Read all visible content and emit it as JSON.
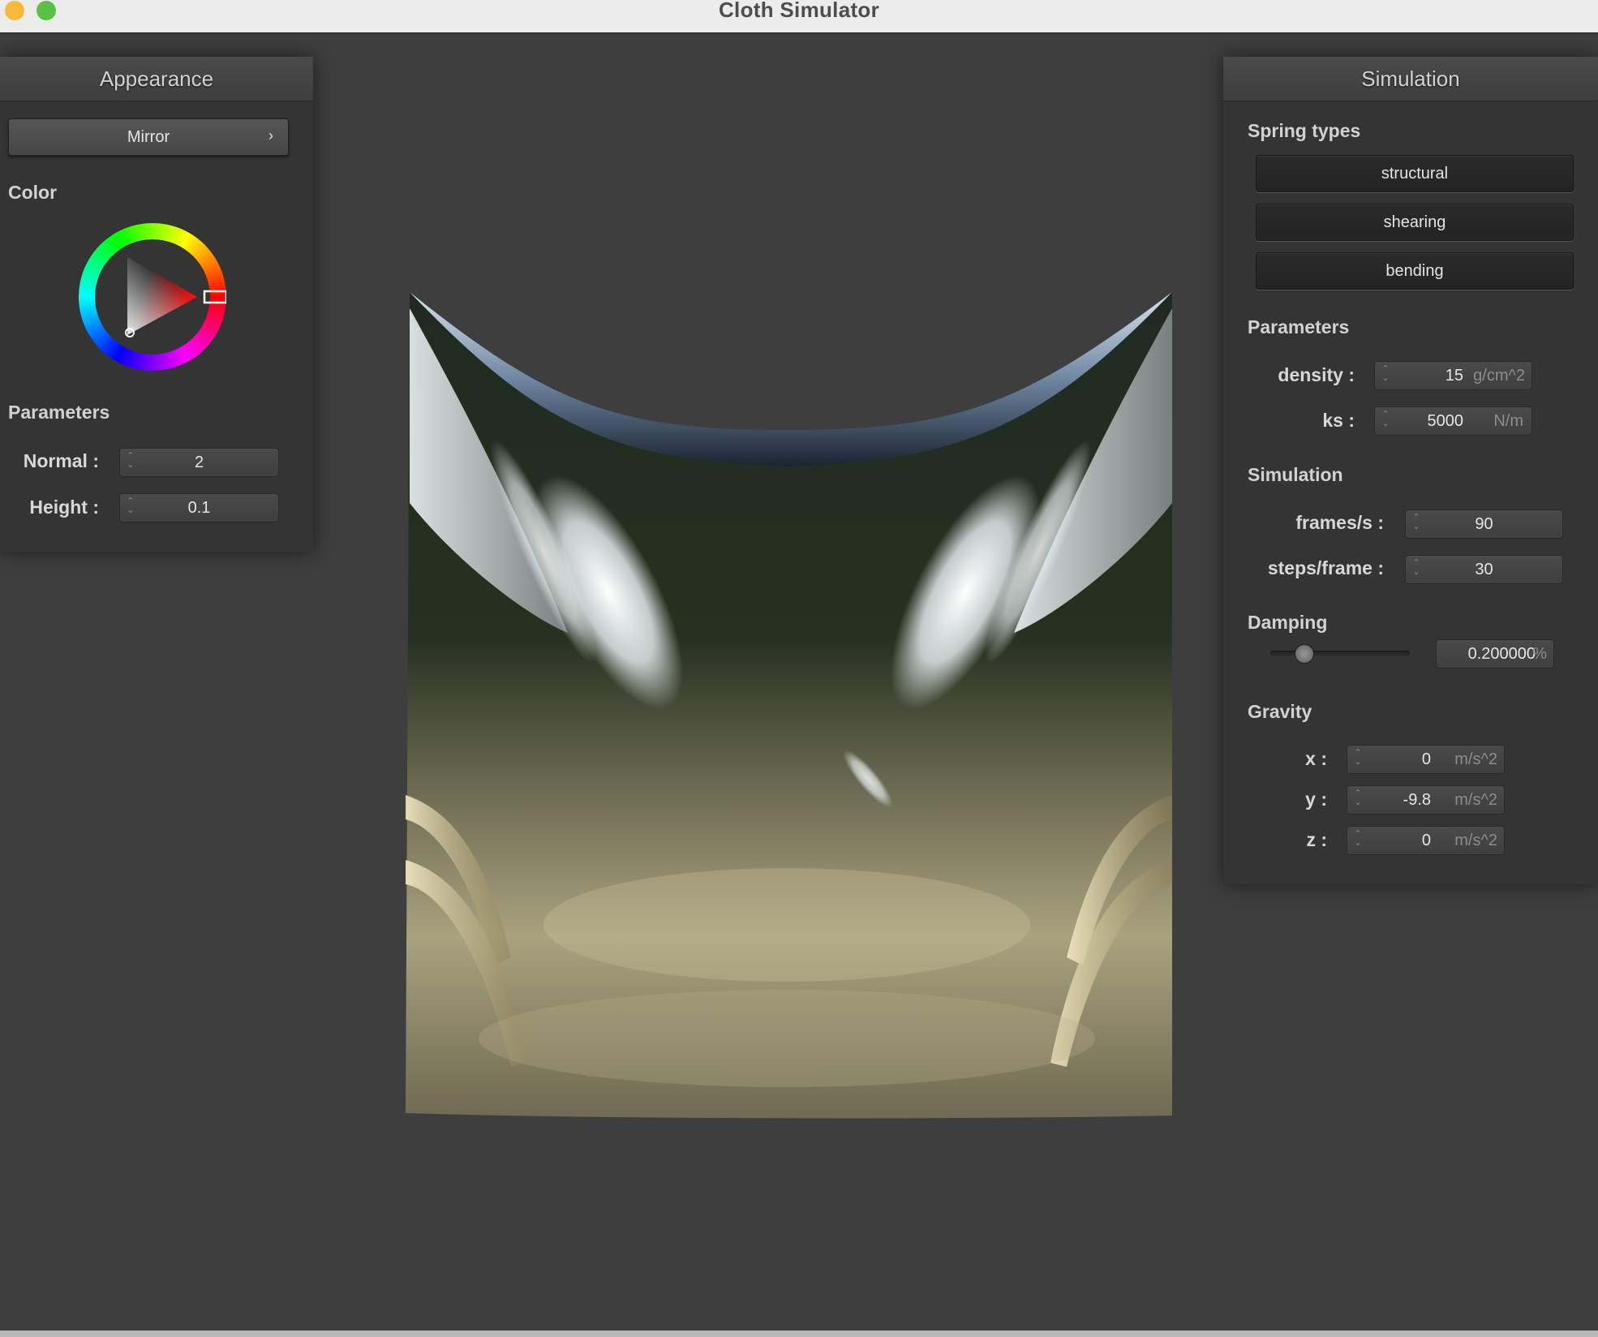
{
  "window": {
    "title": "Cloth Simulator"
  },
  "appearance": {
    "title": "Appearance",
    "shader": "Mirror",
    "color_label": "Color",
    "selected_color": "#e51a1a",
    "parameters_label": "Parameters",
    "normal": {
      "label": "Normal :",
      "value": "2"
    },
    "height": {
      "label": "Height :",
      "value": "0.1"
    }
  },
  "simulation": {
    "title": "Simulation",
    "spring_types_label": "Spring types",
    "springs": [
      "structural",
      "shearing",
      "bending"
    ],
    "parameters_label": "Parameters",
    "density": {
      "label": "density :",
      "value": "15",
      "unit": "g/cm^2"
    },
    "ks": {
      "label": "ks :",
      "value": "5000",
      "unit": "N/m"
    },
    "simulation_label": "Simulation",
    "fps": {
      "label": "frames/s :",
      "value": "90"
    },
    "steps": {
      "label": "steps/frame :",
      "value": "30"
    },
    "damping_label": "Damping",
    "damping": {
      "value": "0.200000",
      "unit": "%",
      "slider_fraction": 0.2
    },
    "gravity_label": "Gravity",
    "gx": {
      "label": "x :",
      "value": "0",
      "unit": "m/s^2"
    },
    "gy": {
      "label": "y :",
      "value": "-9.8",
      "unit": "m/s^2"
    },
    "gz": {
      "label": "z :",
      "value": "0",
      "unit": "m/s^2"
    }
  },
  "icons": {
    "chevron": "chevron-right-icon",
    "spinner": "spinner-icon",
    "window_yellow": "minimize-icon",
    "window_green": "zoom-icon"
  }
}
